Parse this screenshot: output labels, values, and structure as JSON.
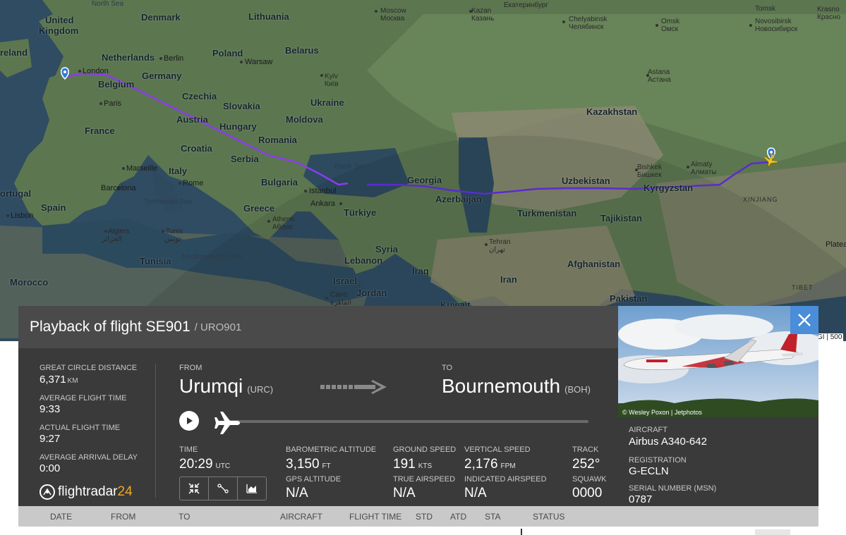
{
  "map": {
    "labels": {
      "north_sea": "North Sea",
      "united_kingdom_1": "United",
      "united_kingdom_2": "Kingdom",
      "ireland": "reland",
      "denmark": "Denmark",
      "lithuania": "Lithuania",
      "netherlands": "Netherlands",
      "berlin": "Berlin",
      "poland": "Poland",
      "warsaw": "Warsaw",
      "belarus": "Belarus",
      "london": "London",
      "belgium": "Belgium",
      "germany": "Germany",
      "czechia": "Czechia",
      "kyiv": "Kyiv",
      "kyiv_local": "Київ",
      "ukraine": "Ukraine",
      "paris": "Paris",
      "slovakia": "Slovakia",
      "france": "France",
      "austria": "Austria",
      "hungary": "Hungary",
      "moldova": "Moldova",
      "romania": "Romania",
      "croatia": "Croatia",
      "marseille": "Marseille",
      "italy": "Italy",
      "serbia": "Serbia",
      "black_sea": "Black Sea",
      "portugal": "ortugal",
      "barcelona": "Barcelona",
      "rome": "Rome",
      "bulgaria": "Bulgaria",
      "istanbul": "Istanbul",
      "spain": "Spain",
      "tyrrhenian_sea": "Tyrrhenian Sea",
      "lisbon": "Lisbon",
      "greece": "Greece",
      "ankara": "Ankara",
      "turkiye": "Türkiye",
      "athens": "Athens",
      "athens_local": "Αθήνα",
      "algiers": "Algiers",
      "algiers_local": "الجزائر",
      "tunis": "Tunis",
      "tunis_local": "تونس",
      "mediterranean_sea": "Mediterranean Sea",
      "tunisia": "Tunisia",
      "morocco": "Morocco",
      "moscow": "Moscow",
      "moscow_local": "Москва",
      "kazan": "Kazan",
      "kazan_local": "Казань",
      "yekaterinburg": "Екатеринбург",
      "chelyabinsk": "Chelyabinsk",
      "chelyabinsk_local": "Челябинск",
      "omsk": "Omsk",
      "omsk_local": "Омск",
      "tomsk": "Tomsk",
      "tomsk_local": "Томск",
      "novosibirsk": "Novosibirsk",
      "novosibirsk_local": "Новосибирск",
      "krasno_1": "Krasno",
      "krasno_2": "Красно",
      "astana": "Astana",
      "astana_local": "Астана",
      "kazakhstan": "Kazakhstan",
      "georgia": "Georgia",
      "uzbekistan": "Uzbekistan",
      "bishkek": "Bishkek",
      "bishkek_local": "Бишкек",
      "almaty": "Almaty",
      "almaty_local": "Алматы",
      "kyrgyzstan": "Kyrgyzstan",
      "azerbaijan": "Azerbaijan",
      "turkmenistan": "Turkmenistan",
      "tajikistan": "Tajikistan",
      "xinjiang": "XINJIANG",
      "tehran": "Tehran",
      "tehran_local": "تهران",
      "syria": "Syria",
      "lebanon": "Lebanon",
      "iraq": "Iraq",
      "iran": "Iran",
      "afghanistan": "Afghanistan",
      "israel": "Israel",
      "jordan": "Jordan",
      "cairo": "Cairo",
      "cairo_local": "القاهرة",
      "kuwait": "Kuwait",
      "pakistan": "Pakistan",
      "tibet": "TIBET",
      "plateau": "Plateau"
    },
    "attribution": "GI | 500"
  },
  "panel": {
    "title": "Playback of flight SE901",
    "subtitle": "/ URO901",
    "stats": {
      "great_circle_label": "GREAT CIRCLE DISTANCE",
      "great_circle_value": "6,371",
      "great_circle_unit": "KM",
      "avg_flight_time_label": "AVERAGE FLIGHT TIME",
      "avg_flight_time_value": "9:33",
      "actual_flight_time_label": "ACTUAL FLIGHT TIME",
      "actual_flight_time_value": "9:27",
      "avg_arrival_delay_label": "AVERAGE ARRIVAL DELAY",
      "avg_arrival_delay_value": "0:00"
    },
    "logo": {
      "text": "flightradar",
      "num": "24"
    },
    "route": {
      "from_label": "FROM",
      "from_city": "Urumqi",
      "from_code": "(URC)",
      "to_label": "TO",
      "to_city": "Bournemouth",
      "to_code": "(BOH)"
    },
    "playback_progress": 0,
    "telemetry": {
      "time_label": "TIME",
      "time_value": "20:29",
      "time_unit": "UTC",
      "baro_alt_label": "BAROMETRIC ALTITUDE",
      "baro_alt_value": "3,150",
      "baro_alt_unit": "FT",
      "ground_speed_label": "GROUND SPEED",
      "ground_speed_value": "191",
      "ground_speed_unit": "KTS",
      "vertical_speed_label": "VERTICAL SPEED",
      "vertical_speed_value": "2,176",
      "vertical_speed_unit": "FPM",
      "track_label": "TRACK",
      "track_value": "252°",
      "gps_alt_label": "GPS ALTITUDE",
      "gps_alt_value": "N/A",
      "true_airspeed_label": "TRUE AIRSPEED",
      "true_airspeed_value": "N/A",
      "indicated_airspeed_label": "INDICATED AIRSPEED",
      "indicated_airspeed_value": "N/A",
      "squawk_label": "SQUAWK",
      "squawk_value": "0000"
    }
  },
  "aircraft_panel": {
    "photo_credit": "© Wesley Poxon | Jetphotos",
    "aircraft_label": "AIRCRAFT",
    "aircraft_value": "Airbus A340-642",
    "registration_label": "REGISTRATION",
    "registration_value": "G-ECLN",
    "serial_label": "SERIAL NUMBER (MSN)",
    "serial_value": "0787"
  },
  "table": {
    "columns": [
      "DATE",
      "FROM",
      "TO",
      "AIRCRAFT",
      "FLIGHT TIME",
      "STD",
      "ATD",
      "STA",
      "STATUS"
    ]
  },
  "colors": {
    "route_purple": "#7a2fd6",
    "route_dark": "#3a1fb0",
    "panel_bg": "#3a3a3a",
    "header_bg": "#4a4a4a",
    "close_blue": "#4a8dd9",
    "logo_orange": "#f5a623"
  }
}
